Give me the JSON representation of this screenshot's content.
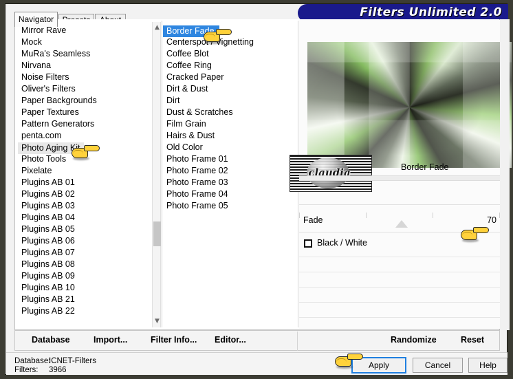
{
  "app": {
    "title": "Filters Unlimited 2.0"
  },
  "tabs": [
    {
      "label": "Navigator",
      "active": true
    },
    {
      "label": "Presets",
      "active": false
    },
    {
      "label": "About",
      "active": false
    }
  ],
  "categories": {
    "selected": "Photo Aging Kit",
    "items": [
      "Mirror Rave",
      "Mock",
      "MuRa's Seamless",
      "Nirvana",
      "Noise Filters",
      "Oliver's Filters",
      "Paper Backgrounds",
      "Paper Textures",
      "Pattern Generators",
      "penta.com",
      "Photo Aging Kit",
      "Photo Tools",
      "Pixelate",
      "Plugins AB 01",
      "Plugins AB 02",
      "Plugins AB 03",
      "Plugins AB 04",
      "Plugins AB 05",
      "Plugins AB 06",
      "Plugins AB 07",
      "Plugins AB 08",
      "Plugins AB 09",
      "Plugins AB 10",
      "Plugins AB 21",
      "Plugins AB 22"
    ]
  },
  "filters": {
    "selected": "Border Fade",
    "items": [
      "Border Fade",
      "Centerspot / Vignetting",
      "Coffee Blot",
      "Coffee Ring",
      "Cracked Paper",
      "Dirt & Dust",
      "Dirt",
      "Dust & Scratches",
      "Film Grain",
      "Hairs & Dust",
      "Old Color",
      "Photo Frame 01",
      "Photo Frame 02",
      "Photo Frame 03",
      "Photo Frame 04",
      "Photo Frame 05"
    ]
  },
  "preview": {
    "filter_name": "Border Fade",
    "watermark_text": "claudia"
  },
  "parameters": {
    "fade": {
      "label": "Fade",
      "value": "70",
      "percent": 40
    },
    "black_white": {
      "label": "Black / White",
      "checked": false
    }
  },
  "toolbar": {
    "database": "Database",
    "import": "Import...",
    "filter_info": "Filter Info...",
    "editor": "Editor...",
    "randomize": "Randomize",
    "reset": "Reset"
  },
  "status": {
    "database_key": "Database:",
    "database_value": "ICNET-Filters",
    "filters_key": "Filters:",
    "filters_value": "3966"
  },
  "buttons": {
    "apply": "Apply",
    "cancel": "Cancel",
    "help": "Help"
  },
  "colors": {
    "banner_blue": "#1a1a8c",
    "selection_blue": "#2f86e0",
    "selection_gray": "#e8e8e8",
    "focus_blue": "#1f7fe0",
    "hand_yellow": "#FFD23B"
  }
}
